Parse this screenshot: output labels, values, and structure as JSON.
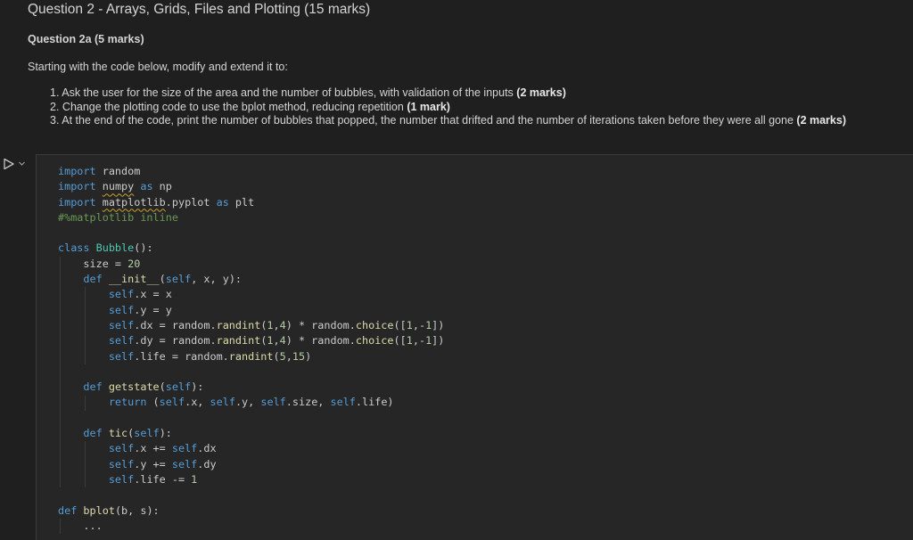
{
  "markdown": {
    "heading": "Question 2 - Arrays, Grids, Files and Plotting (15 marks)",
    "subheading": "Question 2a (5 marks)",
    "intro": "Starting with the code below, modify and extend it to:",
    "steps": [
      {
        "num": "1.",
        "text": "Ask the user for the size of the area and the number of bubbles, with validation of the inputs",
        "marks": "(2 marks)"
      },
      {
        "num": "2.",
        "text": "Change the plotting code to use the bplot method, reducing repetition",
        "marks": "(1 mark)"
      },
      {
        "num": "3.",
        "text": "At the end of the code, print the number of bubbles that popped, the number that drifted and the number of iterations taken before they were all gone",
        "marks": "(2 marks)"
      }
    ]
  },
  "cell": {
    "run_icon": "play-icon",
    "collapse_icon": "chevron-down-icon",
    "code_lines": [
      "import random",
      "import numpy as np",
      "import matplotlib.pyplot as plt",
      "#%matplotlib inline",
      "",
      "class Bubble():",
      "    size = 20",
      "    def __init__(self, x, y):",
      "        self.x = x",
      "        self.y = y",
      "        self.dx = random.randint(1,4) * random.choice([1,-1])",
      "        self.dy = random.randint(1,4) * random.choice([1,-1])",
      "        self.life = random.randint(5,15)",
      "",
      "    def getstate(self):",
      "        return (self.x, self.y, self.size, self.life)",
      "",
      "    def tic(self):",
      "        self.x += self.dx",
      "        self.y += self.dy",
      "        self.life -= 1",
      "",
      "def bplot(b, s):",
      "    ..."
    ]
  }
}
